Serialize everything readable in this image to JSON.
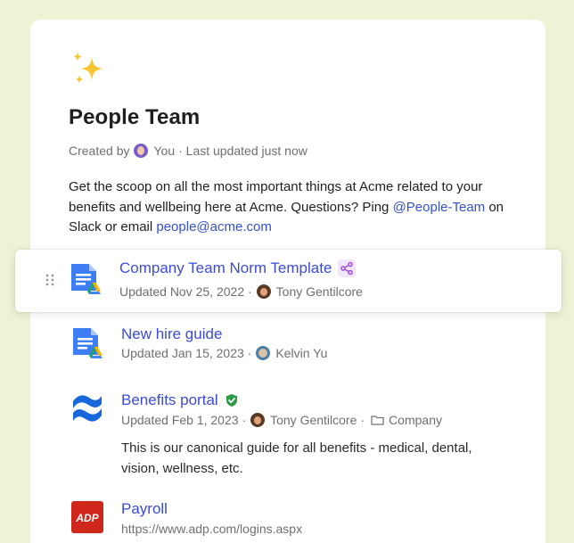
{
  "collection": {
    "title": "People Team",
    "created_prefix": "Created by",
    "created_by": "You",
    "updated": "· Last updated just now",
    "description_part1": "Get the scoop on all the most important things at Acme related to your benefits and wellbeing here at Acme. Questions? Ping ",
    "slack_handle": "@People-Team",
    "description_part2": " on Slack or email ",
    "email": "people@acme.com"
  },
  "items": [
    {
      "title": "Company Team Norm Template",
      "updated": "Updated Nov 25, 2022 ·",
      "author": "Tony Gentilcore",
      "icon": "google-docs-icon"
    },
    {
      "title": "New hire guide",
      "updated": "Updated Jan 15, 2023 ·",
      "author": "Kelvin Yu",
      "icon": "google-docs-icon"
    },
    {
      "title": "Benefits portal",
      "updated": "Updated Feb 1, 2023 ·",
      "author": "Tony Gentilcore",
      "separator": "·",
      "folder": "Company",
      "description": "This is our canonical guide for all benefits - medical, dental, vision, wellness, etc.",
      "icon": "confluence-icon"
    },
    {
      "title": "Payroll",
      "url": "https://www.adp.com/logins.aspx",
      "icon": "adp-icon"
    }
  ],
  "colors": {
    "background": "#eef3d6",
    "link": "#3b4bd8",
    "verified": "#2e9a4a",
    "share": "#a24fd6"
  }
}
